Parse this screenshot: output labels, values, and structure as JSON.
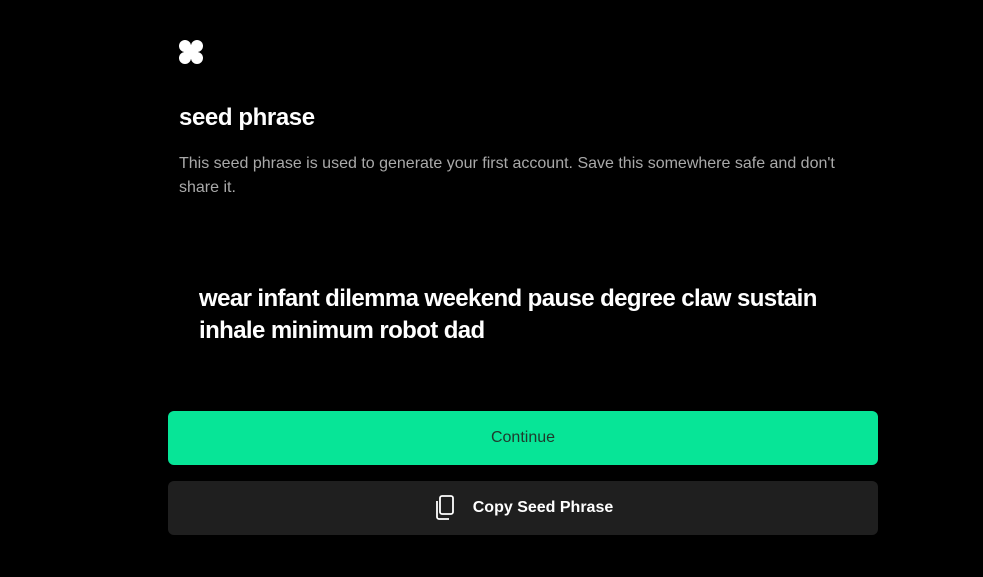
{
  "header": {
    "logo_icon": "four-petal-logo-icon",
    "title": "seed phrase",
    "description": "This seed phrase is used to generate your first account. Save this somewhere safe and don't share it."
  },
  "seed": {
    "phrase": "wear infant dilemma weekend pause degree claw sustain inhale minimum robot dad"
  },
  "actions": {
    "continue_label": "Continue",
    "copy_label": "Copy Seed Phrase",
    "copy_icon": "copy-icon"
  },
  "colors": {
    "accent": "#07e597",
    "background": "#000000",
    "secondary_button": "#1f1f1f"
  }
}
